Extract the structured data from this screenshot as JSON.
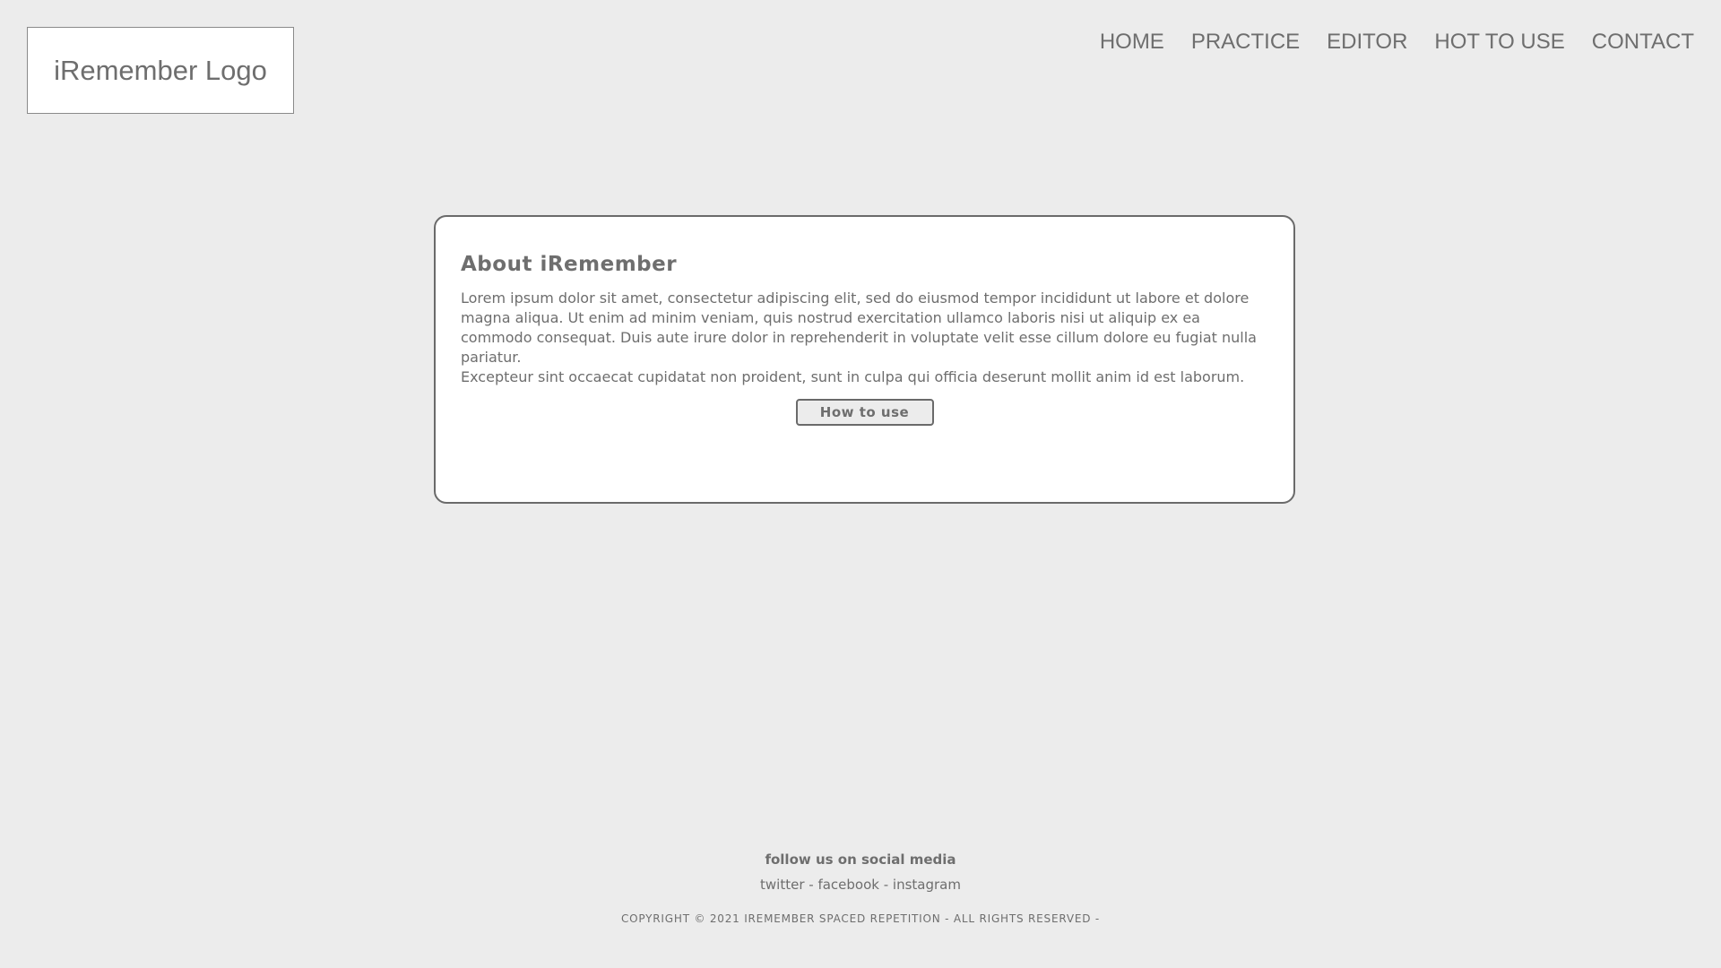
{
  "header": {
    "logo_text": "iRemember Logo",
    "nav": {
      "home": "HOME",
      "practice": "PRACTICE",
      "editor": "EDITOR",
      "how_to_use": "HOT TO USE",
      "contact": "CONTACT"
    }
  },
  "about": {
    "title": "About iRemember",
    "paragraphs": [
      "Lorem ipsum dolor sit amet, consectetur adipiscing elit, sed do eiusmod tempor incididunt ut labore et dolore",
      "magna aliqua. Ut enim ad minim veniam, quis nostrud exercitation ullamco laboris nisi ut aliquip ex ea commodo consequat. Duis aute irure dolor in reprehenderit in voluptate velit esse cillum dolore eu fugiat nulla pariatur.",
      "Excepteur sint occaecat cupidatat non proident, sunt in culpa qui officia deserunt mollit anim id est laborum."
    ],
    "button_label": "How to use"
  },
  "footer": {
    "heading": "follow us on social media",
    "social": {
      "twitter": "twitter",
      "facebook": "facebook",
      "instagram": "instagram",
      "separator": " - "
    },
    "copyright": "COPYRIGHT © 2021 IREMEMBER SPACED REPETITION - ALL RIGHTS RESERVED -"
  },
  "colors": {
    "background": "#ececec",
    "card": "#ffffff",
    "text": "#6e6e6e",
    "border": "#6a6a6a"
  }
}
